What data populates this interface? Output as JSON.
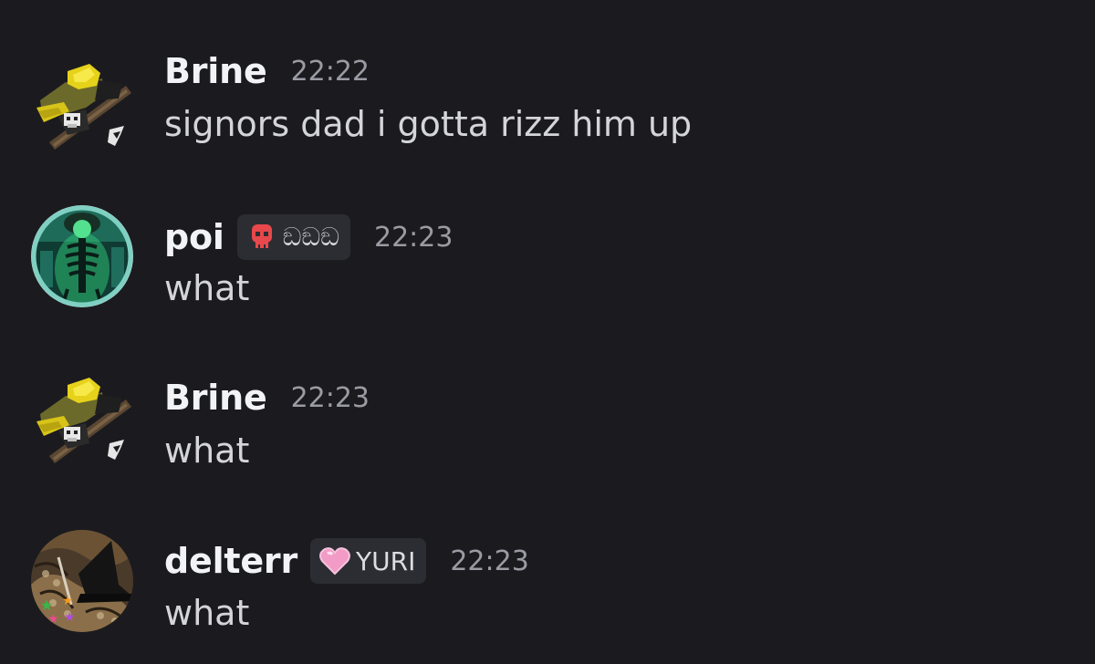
{
  "messages": [
    {
      "author": "Brine",
      "time": "22:22",
      "text": "signors dad i gotta rizz him up",
      "avatar_icon": "pixel-helmet-skull-icon"
    },
    {
      "author": "poi",
      "tag": {
        "icon": "red-skull-icon",
        "label": "ඞඞඞ"
      },
      "time": "22:23",
      "text": "what",
      "avatar_icon": "green-skeleton-icon"
    },
    {
      "author": "Brine",
      "time": "22:23",
      "text": "what",
      "avatar_icon": "pixel-helmet-skull-icon"
    },
    {
      "author": "delterr",
      "tag": {
        "icon": "pink-heart-icon",
        "label": "YURI"
      },
      "time": "22:23",
      "text": "what",
      "avatar_icon": "witch-hat-snake-icon"
    }
  ],
  "colors": {
    "background": "#1b1b1f",
    "username": "#f2f3f5",
    "timestamp": "#9a9ba3",
    "message": "#d4d5da",
    "tag_background": "#2c2d33"
  }
}
